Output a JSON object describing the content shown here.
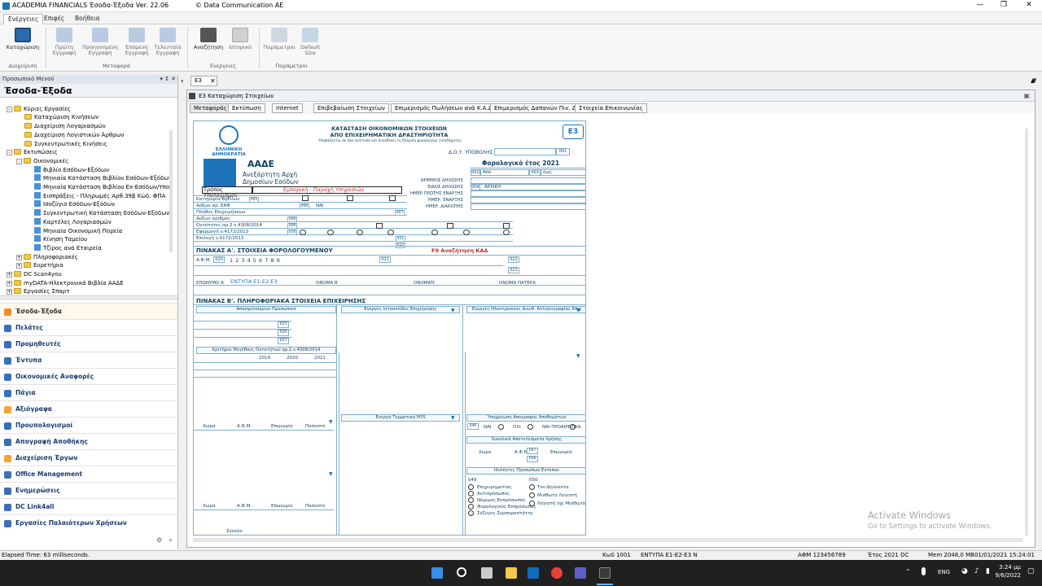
{
  "window": {
    "title": "ACADEMIA FINANCIALS Έσοδα-Έξοδα Ver. 22.06",
    "company": "© Data Communication AE"
  },
  "menu_tabs": [
    "Ενέργειες",
    "Επιφές",
    "Βοήθεια"
  ],
  "ribbon": {
    "buttons": [
      "Καταχώριση",
      "Πρώτη Εγγραφή",
      "Προηγούμενη Εγγραφή",
      "Επόμενη Εγγραφή",
      "Τελευταία Εγγραφή",
      "Αναζήτηση",
      "Ιστορικό",
      "Παράμετροι",
      "Default Size"
    ],
    "groups": [
      "Διαχείριση",
      "Μεταφορά",
      "Ενέργειες",
      "Παράμετροι"
    ]
  },
  "left_panel": {
    "header": "Προσωπικό Μενού",
    "title": "Έσοδα-Έξοδα",
    "tree": [
      "Κύριες Εργασίες",
      "Καταχώριση Κινήσεων",
      "Διαχείριση Λογαριασμών",
      "Διαχείριση Λογιστικών Άρθρων",
      "Συγκεντρωτικές Κινήσεις",
      "Εκτυπώσεις",
      "Οικονομικές",
      "Βιβλίο Εσόδων-Εξόδων",
      "Μηνιαία Κατάσταση Βιβλίου Εσόδων-Εξόδων",
      "Μηνιαία Κατάσταση Βιβλίου Ex-Εσόδων/Υποι",
      "Εισπράξεις - Πληρωμές Αρθ.39β Κώδ. ΦΠΑ",
      "Ισοζύγιο Εσόδων-Εξόδων",
      "Συγκεντρωτική Κατάσταση Εσόδων-Εξόδων",
      "Καρτέλες Λογαριασμών",
      "Μηνιαία Οικονομική Πορεία",
      "Κίνηση Ταμείου",
      "Τζίρος ανά Εταιρεία",
      "Πληροφοριακές",
      "Ευρετήρια",
      "DC Scan4you",
      "myDATA-Ηλεκτρονικά Βιβλία ΑΑΔΕ",
      "Εργασίες Σπαρτ"
    ],
    "nav": [
      "Έσοδα-Έξοδα",
      "Πελάτες",
      "Προμηθευτές",
      "Έντυπα",
      "Οικονομικές Αναφορές",
      "Πάγια",
      "Αξιόγραφα",
      "Προυπολογισμοί",
      "Απογραφή Αποθήκης",
      "Διαχείριση Έργων",
      "Office Management",
      "Ενημερώσεις",
      "DC Link4all",
      "Εργασίες Παλαιότερων Χρήσεων"
    ]
  },
  "doc_tab": "E3",
  "inner_window": {
    "title": "E3 Καταχώριση Στοιχείων",
    "tabs": [
      "Μεταφοράς",
      "Εκτύπωση",
      "Internet",
      "Επιβεβαίωση Στοιχείων",
      "Επιμερισμός Πωλήσεων ανά Κ.Α.Δ.",
      "Επιμερισμός Δαπανών Πιν. Δ",
      "Στοιχεία Επικοινωνίας"
    ]
  },
  "form": {
    "heading1": "ΚΑΤΑΣΤΑΣΗ ΟΙΚΟΝΟΜΙΚΩΝ ΣΤΟΙΧΕΙΩΝ",
    "heading2": "ΑΠΟ ΕΠΙΧΕΙΡΗΜΑΤΙΚΗ ΔΡΑΣΤΗΡΙΟΤΗΤΑ",
    "heading_note": "Υποβάλλεται σε ένα αντίτυπο και συνοδεύει τη δήλωση φορολογίας εισοδήματος",
    "badge": "E3",
    "republic": "ΕΛΛΗΝΙΚΗ ΔΗΜΟΚΡΑΤΙΑ",
    "aade": "ΑΑΔΕ",
    "aade_sub1": "Ανεξάρτητη Αρχή",
    "aade_sub2": "Δημοσίων Εσόδων",
    "doy": "Δ.Ο.Υ. ΥΠΟΒΟΛΗΣ",
    "tax_year": "Φορολογικό έτος 2021",
    "fields_right": [
      "ΑΡΙΘΜΟΣ ΔΗΛΩΣΗΣ",
      "ΕΙΔΟΣ ΔΗΛΩΣΗΣ",
      "ΗΜΕΡ.ΠΡΩΤΗΣ ΕΝΑΡΞΗΣ",
      "ΗΜΕΡ. ΕΝΑΡΞΗΣ",
      "ΗΜΕΡ. ΔΙΑΚΟΠΗΣ"
    ],
    "codes_right": [
      "001",
      "002",
      "003",
      "004"
    ],
    "from_label": "Από",
    "to_label": "έως",
    "eidos_value": "ΑΡΧΙΚΗ",
    "tropos_label": "Τρόπος Υπολογισμού",
    "tropos_value": "Εμπορική - Παροχή Υπηρεσιών",
    "table_a": "ΠΙΝΑΚΑΣ Α'.   ΣΤΟΙΧΕΙΑ ΦΟΡΟΛΟΓΟΥΜΕΝΟΥ",
    "f9": "F9 Αναζήτηση ΚΑΔ",
    "afm_digits": "1  2  3  4  5  6  7  8  9",
    "entypa": "ΕΝΤΥΠΑ Ε1-Ε2-Ε3",
    "onoma_value": "Ν",
    "table_b": "ΠΙΝΑΚΑΣ Β'.   ΠΛΗΡΟΦΟΡΙΑΚΑ ΣΤΟΙΧΕΙΑ ΕΠΙΧΕΙΡΗΣΗΣ",
    "years": [
      "2019",
      "2020",
      "2021"
    ],
    "sub_labels": [
      "Απασχολούμενο Προσωπικό",
      "Ενεργές Ιστοσελίδες Επιχείρησης",
      "Ενεργές Ηλεκτρονικές Διευθ. Αλληλογραφίας Επιχ",
      "Κριτήρια Μεγέθους Οντοτήτων αρ.2 ν.4308/2014",
      "Ενεργά Τερματικά POS",
      "Υποχρέωση Απογραφής Αποθεμάτων",
      "Συνολικά Αποτελέσματα Χρήσης",
      "Ιδιότητες Προσώπων Εντύπου"
    ],
    "cols_afm": [
      "Χώρα",
      "Α.Φ.Μ.",
      "Επωνυμία",
      "Ποσοστό"
    ],
    "options_049": [
      "Επιχειρηματίας",
      "Αντιπρόσωπος",
      "Νόμιμος Εκπρόσωπος",
      "Φορολογικός Εκπρόσωπος",
      "Σύζυγος Συμπαραστάτης"
    ],
    "options_050": [
      "Τον Δηλούντα",
      "Μισθωτό Λογιστή",
      "Λογιστή όχι Μισθωτό"
    ],
    "nai_oxi": [
      "ΝΑΙ",
      "ΟΧΙ",
      "ΝΑΙ ΠΡΟΑΙΡΕΤΙΚΑ"
    ],
    "synolo": "Σύνολο"
  },
  "status": {
    "elapsed": "Elapsed Time: 63 milliseconds.",
    "kod": "Κωδ 1001",
    "entypo": "ΕΝΤΥΠΑ Ε1-Ε2-Ε3  Ν",
    "afm": "ΑΦΜ 123456789",
    "etos": "Έτος 2021  DC",
    "mem": "Mem 2048,0 MB",
    "datetime": "01/01/2021 15:24:01"
  },
  "watermark": {
    "line1": "Activate Windows",
    "line2": "Go to Settings to activate Windows."
  },
  "taskbar": {
    "lang": "ENG",
    "time": "3:24 μμ",
    "date": "9/6/2022"
  },
  "colors": {
    "accent": "#1e72b8",
    "form_line": "#7fb0c8",
    "form_text": "#0f3f5e",
    "red": "#c62828",
    "taskbar": "#202020"
  }
}
